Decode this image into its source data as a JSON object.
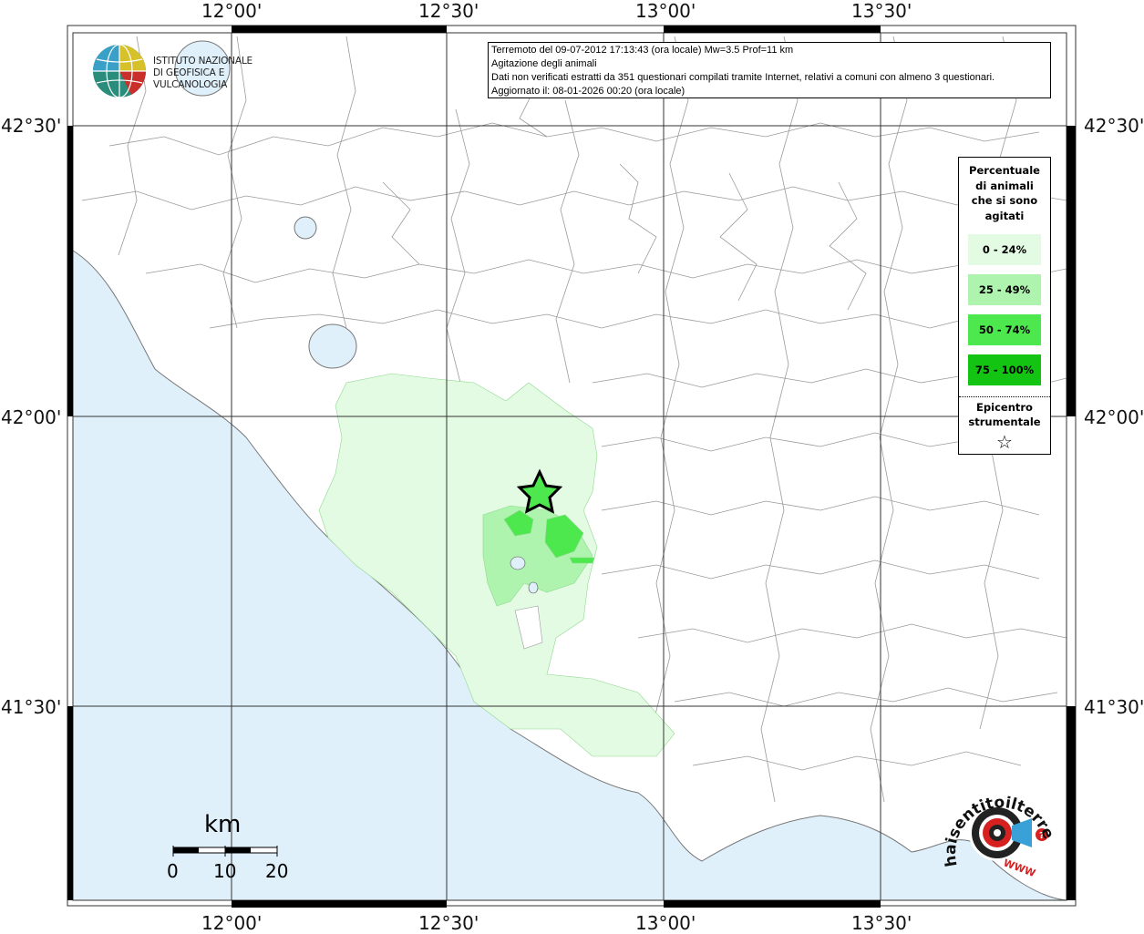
{
  "info": {
    "line1": "Terremoto del 09-07-2012 17:13:43 (ora locale) Mw=3.5 Prof=11 km",
    "line2": "Agitazione degli animali",
    "line3": "Dati non verificati estratti da 351 questionari compilati tramite Internet, relativi a comuni con almeno 3 questionari.",
    "line4": "Aggiornato il: 08-01-2026 00:20 (ora locale)"
  },
  "logo": {
    "line1": "ISTITUTO NAZIONALE",
    "line2": "DI GEOFISICA E VULCANOLOGIA"
  },
  "legend": {
    "title_line1": "Percentuale",
    "title_line2": "di animali",
    "title_line3": "che si sono",
    "title_line4": "agitati",
    "classes": [
      {
        "label": "0 - 24%",
        "color": "#e3fbe3"
      },
      {
        "label": "25 - 49%",
        "color": "#aef3ae"
      },
      {
        "label": "50 - 74%",
        "color": "#4de84d"
      },
      {
        "label": "75 - 100%",
        "color": "#13c413"
      }
    ],
    "epicentre_line1": "Epicentro",
    "epicentre_line2": "strumentale",
    "star_symbol": "☆"
  },
  "axes": {
    "lon_labels": [
      "12°00'",
      "12°30'",
      "13°00'",
      "13°30'"
    ],
    "lat_labels": [
      "42°30'",
      "42°00'",
      "41°30'"
    ]
  },
  "scale": {
    "unit": "km",
    "ticks": [
      "0",
      "10",
      "20"
    ]
  },
  "brand": {
    "text": "haisentitoilterremoto.it",
    "www": "WWW"
  },
  "colors": {
    "sea": "#dff0fb",
    "land": "#ffffff",
    "boundary": "#9a9a9a",
    "epicentre_fill": "#4de84d"
  }
}
